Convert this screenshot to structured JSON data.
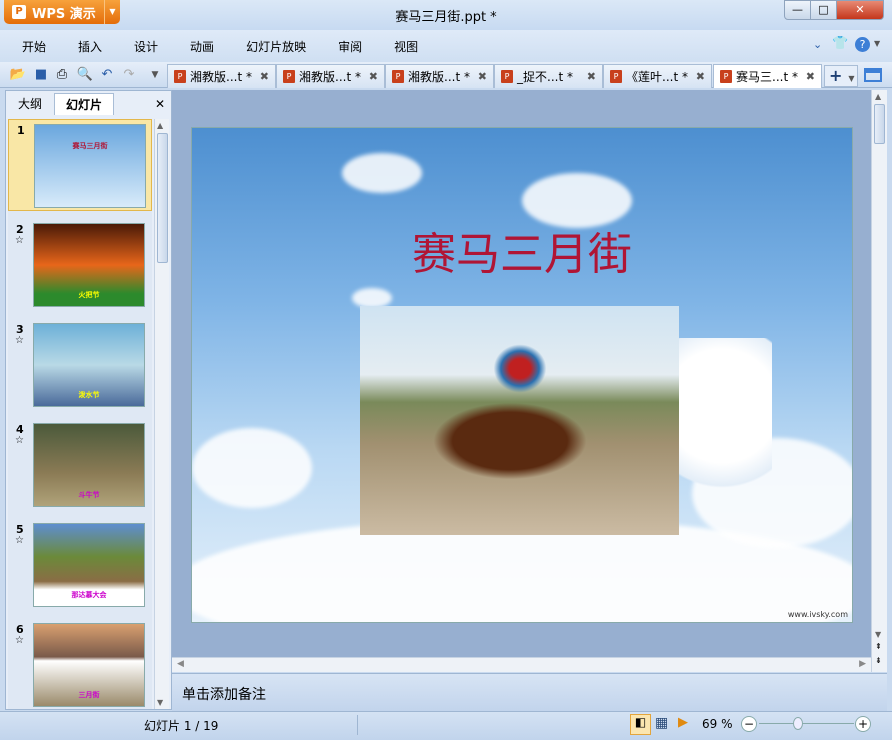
{
  "app": {
    "name": "WPS 演示",
    "title": "赛马三月街.ppt *"
  },
  "window": {
    "minimize": "—",
    "maximize": "□",
    "close": "✕"
  },
  "menu": [
    "开始",
    "插入",
    "设计",
    "动画",
    "幻灯片放映",
    "审阅",
    "视图"
  ],
  "doc_tabs": [
    {
      "label": "湘教版...t *",
      "active": false
    },
    {
      "label": "湘教版...t *",
      "active": false
    },
    {
      "label": "湘教版...t *",
      "active": false
    },
    {
      "label": "_捉不...t *",
      "active": false
    },
    {
      "label": "《莲叶...t *",
      "active": false
    },
    {
      "label": "赛马三...t *",
      "active": true
    }
  ],
  "panel": {
    "tabs": [
      "大纲",
      "幻灯片"
    ],
    "close": "✕"
  },
  "thumbnails": [
    {
      "num": "1",
      "title": "赛马三月街",
      "bg": "linear-gradient(#6aa7de,#d8ebfa)",
      "color": "#b01535"
    },
    {
      "num": "2",
      "title": "火把节",
      "bg": "linear-gradient(#4a1a08,#e8661a 50%,#2c8a2c 85%)",
      "color": "#ff0"
    },
    {
      "num": "3",
      "title": "泼水节",
      "bg": "linear-gradient(#6db0d8,#b9d9e6 50%,#4a6a9a)",
      "color": "#ff0"
    },
    {
      "num": "4",
      "title": "斗牛节",
      "bg": "linear-gradient(#4b5a3b,#8b7b55 60%,#b0a37a)",
      "color": "#c0c"
    },
    {
      "num": "5",
      "title": "那达慕大会",
      "bg": "linear-gradient(#5e8ed0,#6b8a3a 40%,#8a6d45 70%,#fff 80%)",
      "color": "#c0c"
    },
    {
      "num": "6",
      "title": "三月街",
      "bg": "linear-gradient(#d9a070,#7a5a4a 40%,#fff 45%,#9a8a6a)",
      "color": "#c0c"
    }
  ],
  "slide": {
    "title": "赛马三月街",
    "watermark": "www.ivsky.com"
  },
  "notes": {
    "placeholder": "单击添加备注"
  },
  "status": {
    "slide_info": "幻灯片 1 / 19",
    "zoom": "69 %",
    "zoom_fraction": 0.4
  }
}
